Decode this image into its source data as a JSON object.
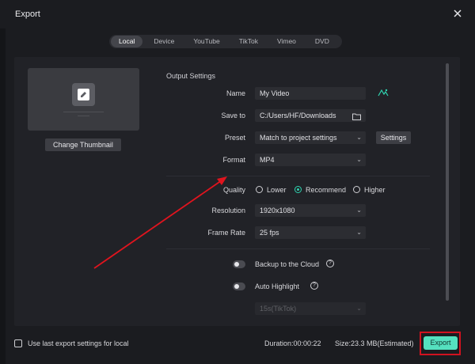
{
  "window": {
    "title": "Export"
  },
  "tabs": [
    {
      "label": "Local",
      "active": true
    },
    {
      "label": "Device",
      "active": false
    },
    {
      "label": "YouTube",
      "active": false
    },
    {
      "label": "TikTok",
      "active": false
    },
    {
      "label": "Vimeo",
      "active": false
    },
    {
      "label": "DVD",
      "active": false
    }
  ],
  "thumbnail": {
    "change_label": "Change Thumbnail"
  },
  "output": {
    "section_title": "Output Settings",
    "name_label": "Name",
    "name_value": "My Video",
    "save_to_label": "Save to",
    "save_to_value": "C:/Users/HF/Downloads",
    "preset_label": "Preset",
    "preset_value": "Match to project settings",
    "settings_button": "Settings",
    "format_label": "Format",
    "format_value": "MP4",
    "quality_label": "Quality",
    "quality_options": [
      "Lower",
      "Recommend",
      "Higher"
    ],
    "quality_selected": "Recommend",
    "resolution_label": "Resolution",
    "resolution_value": "1920x1080",
    "frame_rate_label": "Frame Rate",
    "frame_rate_value": "25 fps",
    "backup_label": "Backup to the Cloud",
    "auto_highlight_label": "Auto Highlight",
    "highlight_preset_value": "15s(TikTok)"
  },
  "footer": {
    "use_last_label": "Use last export settings for local",
    "duration": "Duration:00:00:22",
    "size": "Size:23.3 MB(Estimated)",
    "export_button": "Export"
  },
  "colors": {
    "accent": "#55e0bf",
    "highlight_box": "#d1121f",
    "annotation_arrow": "#e0141e"
  }
}
